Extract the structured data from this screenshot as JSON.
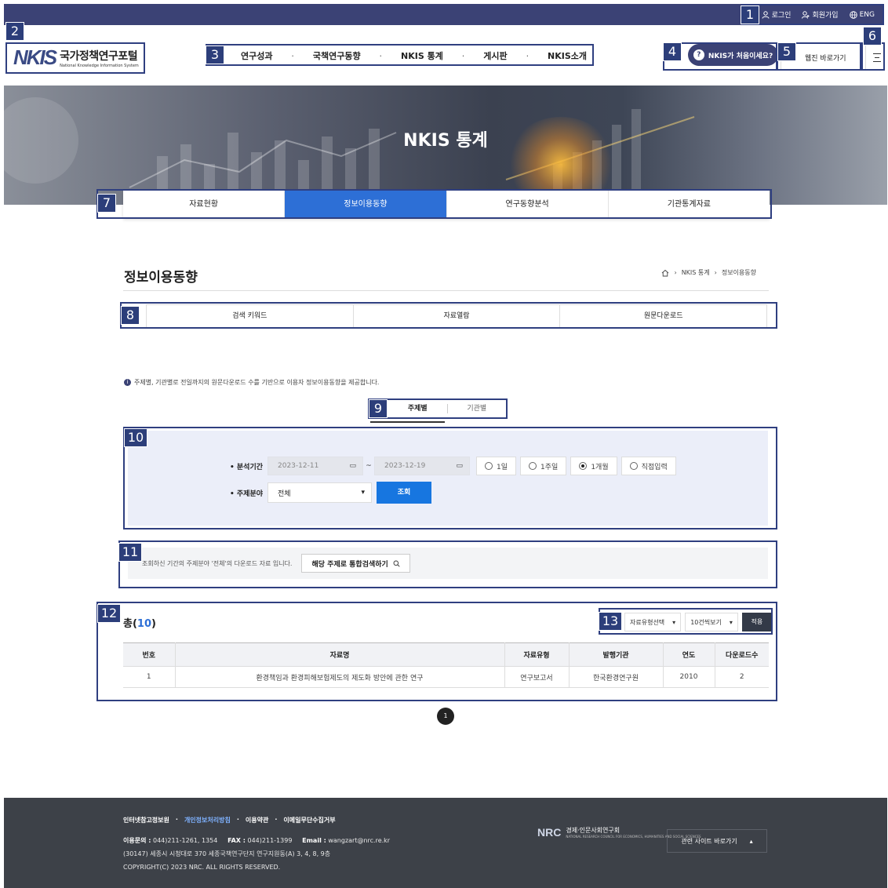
{
  "topbar": {
    "login": "로그인",
    "signup": "회원가입",
    "lang": "ENG"
  },
  "logo": {
    "mark": "NKIS",
    "title_ko": "국가정책연구포털",
    "title_en": "National Knowledge Information System"
  },
  "gnb": [
    "연구성과",
    "국책연구동향",
    "NKIS 통계",
    "게시판",
    "NKIS소개"
  ],
  "header": {
    "first_visit": "NKIS가 처음이세요?",
    "webzine": "웹진 바로가기"
  },
  "hero": {
    "title": "NKIS 통계"
  },
  "subtabs": [
    {
      "label": "자료현황",
      "active": false
    },
    {
      "label": "정보이용동향",
      "active": true
    },
    {
      "label": "연구동향분석",
      "active": false
    },
    {
      "label": "기관통계자료",
      "active": false
    }
  ],
  "page": {
    "title": "정보이용동향",
    "breadcrumb": [
      "NKIS 통계",
      "정보이용동향"
    ]
  },
  "innertabs": [
    "검색 키워드",
    "자료열람",
    "원문다운로드"
  ],
  "notice": "주제별, 기관별로 전일까지의 원문다운로드 수를 기반으로 이용자 정보이용동향을 제공합니다.",
  "toggle": {
    "subject": "주제별",
    "institution": "기관별"
  },
  "search": {
    "period_label": "• 분석기간",
    "start_date": "2023-12-11",
    "end_date": "2023-12-19",
    "tilde": "~",
    "ranges": [
      {
        "label": "1일",
        "checked": false
      },
      {
        "label": "1주일",
        "checked": false
      },
      {
        "label": "1개월",
        "checked": true
      },
      {
        "label": "직접입력",
        "checked": false
      }
    ],
    "field_label": "• 주제분야",
    "field_value": "전체",
    "search_button": "조회"
  },
  "result_info": {
    "text": "조회하신 기간의 주제분야 '전체'의 다운로드 자료 입니다.",
    "button": "해당 주제로 통합검색하기"
  },
  "results": {
    "total_prefix": "총(",
    "total_count": "10",
    "total_suffix": ")",
    "type_filter": "자료유형선택",
    "page_size": "10건씩보기",
    "apply": "적용",
    "columns": [
      "번호",
      "자료명",
      "자료유형",
      "발행기관",
      "연도",
      "다운로드수"
    ],
    "rows": [
      [
        "1",
        "환경책임과 환경피해보험제도의 제도화 방안에 관한 연구",
        "연구보고서",
        "한국환경연구원",
        "2010",
        "2"
      ]
    ]
  },
  "pagination": {
    "current": "1"
  },
  "footer": {
    "links": [
      "인터넷참고정보원",
      "개인정보처리방침",
      "이용약관",
      "이메일무단수집거부"
    ],
    "contact_label": "이용문의 :",
    "contact_value": "044)211-1261, 1354",
    "fax_label": "FAX :",
    "fax_value": "044)211-1399",
    "email_label": "Email :",
    "email_value": "wangzart@nrc.re.kr",
    "address": "(30147) 세종시 시청대로 370 세종국책연구단지 연구지원동(A) 3, 4, 8, 9층",
    "copyright": "COPYRIGHT(C) 2023 NRC. ALL RIGHTS RESERVED.",
    "nrc_name": "경제·인문사회연구회",
    "nrc_en": "NATIONAL RESEARCH COUNCIL FOR ECONOMICS, HUMANITIES AND SOCIAL SCIENCES",
    "nrc_mark": "NRC",
    "related_sites": "관련 사이트 바로가기"
  },
  "markers": [
    "1",
    "2",
    "3",
    "4",
    "5",
    "6",
    "7",
    "8",
    "9",
    "10",
    "11",
    "12",
    "13"
  ],
  "colors": {
    "navy": "#3b4275",
    "active_tab": "#2d6fd6",
    "search_button": "#1776e0",
    "search_panel": "#ebeef9",
    "footer": "#3d4148"
  }
}
